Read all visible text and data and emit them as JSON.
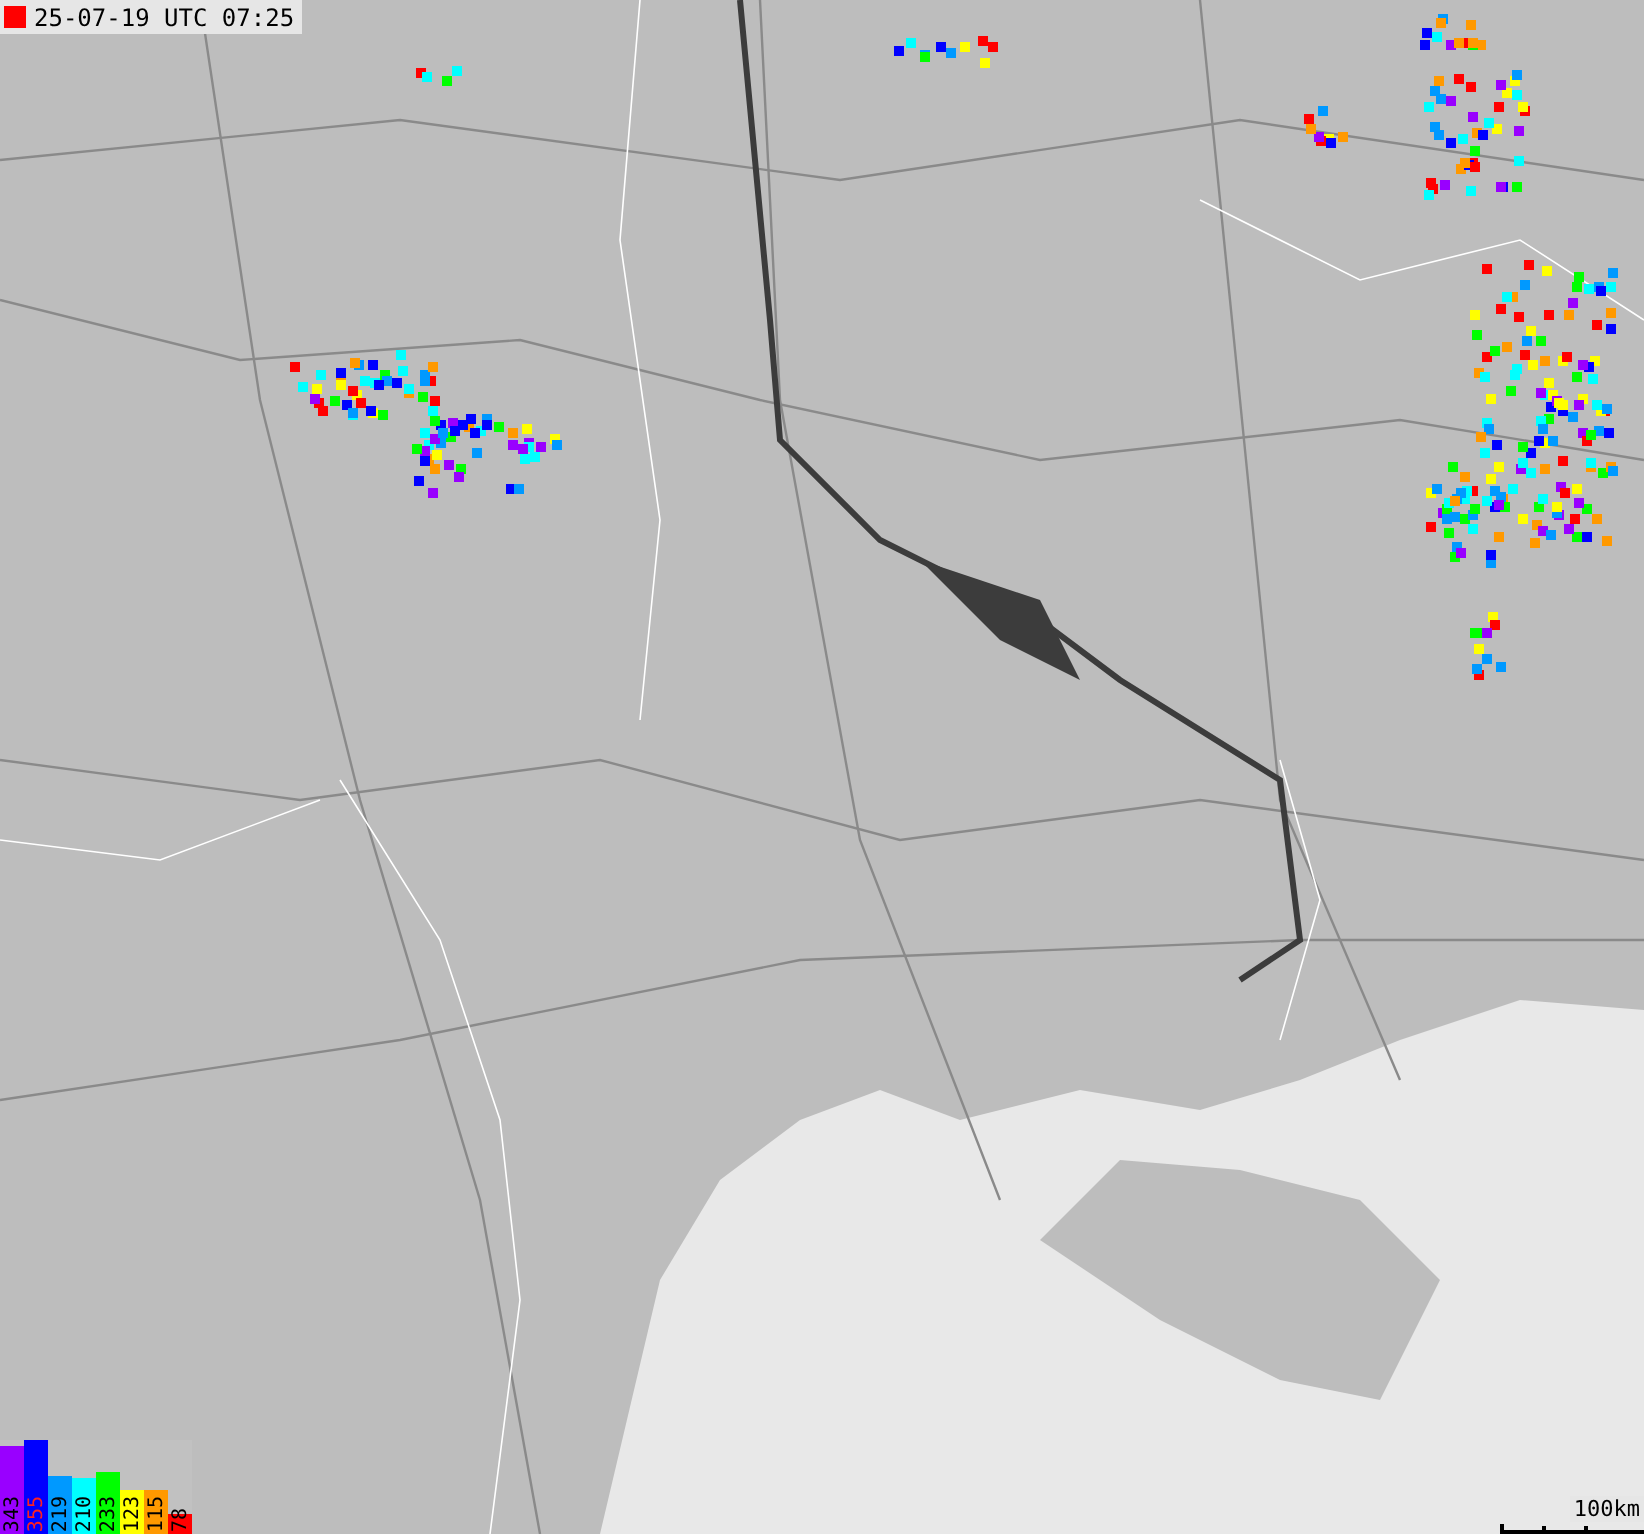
{
  "timestamp": {
    "text": "25-07-19 UTC 07:25"
  },
  "legend": [
    {
      "label": "343",
      "color": "#9900ff",
      "level": 0.94
    },
    {
      "label": "355",
      "color": "#0000ff",
      "level": 1
    },
    {
      "label": "219",
      "color": "#0099ff",
      "level": 0.62
    },
    {
      "label": "210",
      "color": "#00ffff",
      "level": 0.6
    },
    {
      "label": "233",
      "color": "#00ff00",
      "level": 0.66
    },
    {
      "label": "123",
      "color": "#ffff00",
      "level": 0.47
    },
    {
      "label": "115",
      "color": "#ff9900",
      "level": 0.47
    },
    {
      "label": "78",
      "color": "#ff0000",
      "level": 0.22
    }
  ],
  "scale": {
    "label": "100km"
  }
}
